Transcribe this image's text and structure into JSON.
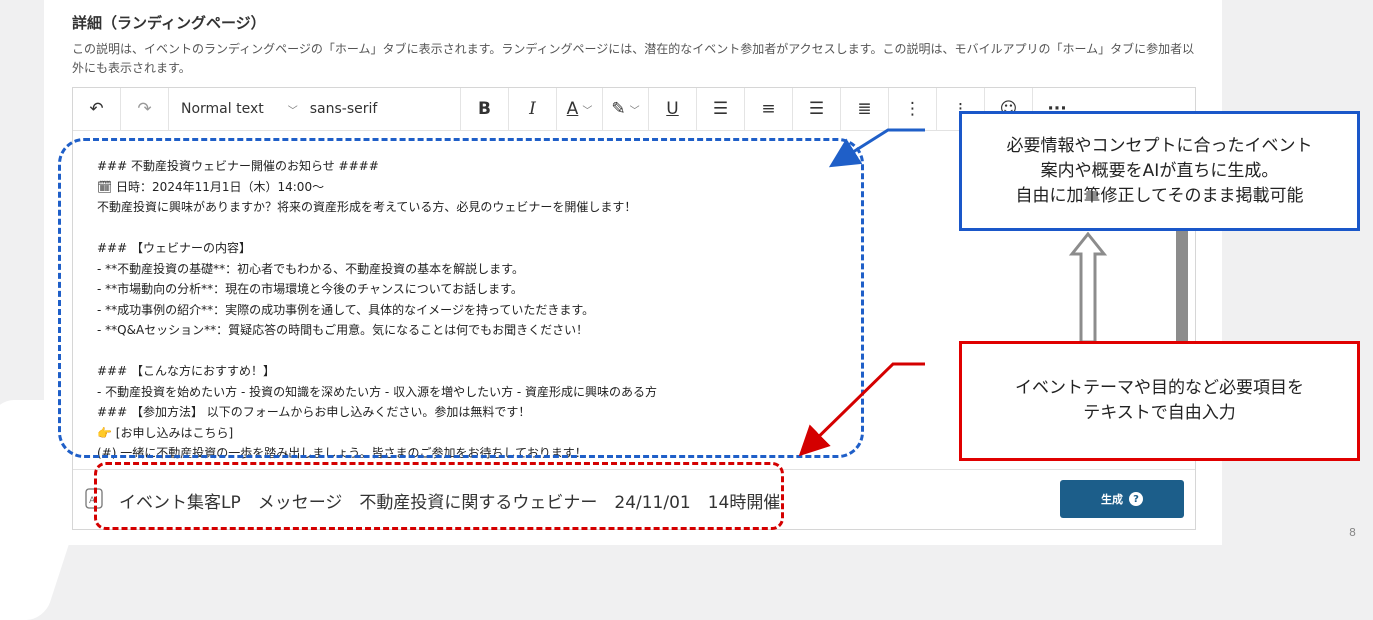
{
  "section": {
    "title": "詳細（ランディングページ）",
    "description": "この説明は、イベントのランディングページの「ホーム」タブに表示されます。ランディングページには、潜在的なイベント参加者がアクセスします。この説明は、モバイルアプリの「ホーム」タブに参加者以外にも表示されます。"
  },
  "toolbar": {
    "undo": "↶",
    "redo": "↷",
    "paragraph_style": "Normal text",
    "font_family": "sans-serif",
    "bold": "B",
    "italic": "I",
    "font_color": "A",
    "underline": "U",
    "more": "···"
  },
  "editor": {
    "lines": [
      "### 不動産投資ウェビナー開催のお知らせ ####",
      "🗓 日時：2024年11月1日（木）14:00～",
      "不動産投資に興味がありますか？将来の資産形成を考えている方、必見のウェビナーを開催します！",
      "",
      "### 【ウェビナーの内容】",
      "- **不動産投資の基礎**：初心者でもわかる、不動産投資の基本を解説します。",
      "- **市場動向の分析**：現在の市場環境と今後のチャンスについてお話します。",
      "- **成功事例の紹介**：実際の成功事例を通して、具体的なイメージを持っていただきます。",
      "- **Q&Aセッション**：質疑応答の時間もご用意。気になることは何でもお聞きください！",
      "",
      "### 【こんな方におすすめ！】",
      "- 不動産投資を始めたい方 - 投資の知識を深めたい方 - 収入源を増やしたい方 - 資産形成に興味のある方",
      "### 【参加方法】 以下のフォームからお申し込みください。参加は無料です！",
      "👉 [お申し込みはこちら]",
      "(#) 一緒に不動産投資の一歩を踏み出しましょう。皆さまのご参加をお待ちしております！"
    ]
  },
  "generator": {
    "prompt": "イベント集客LP　メッセージ　不動産投資に関するウェビナー　24/11/01　14時開催",
    "button_label": "生成",
    "help": "?"
  },
  "callouts": {
    "blue": [
      "必要情報やコンセプトに合ったイベント",
      "案内や概要をAIが直ちに生成。",
      "自由に加筆修正してそのまま掲載可能"
    ],
    "red": [
      "イベントテーマや目的など必要項目を",
      "テキストで自由入力"
    ]
  },
  "page_number": "8",
  "colors": {
    "blue_annotation": "#1f5fc8",
    "red_annotation": "#d40000",
    "button": "#1c5e8a"
  }
}
